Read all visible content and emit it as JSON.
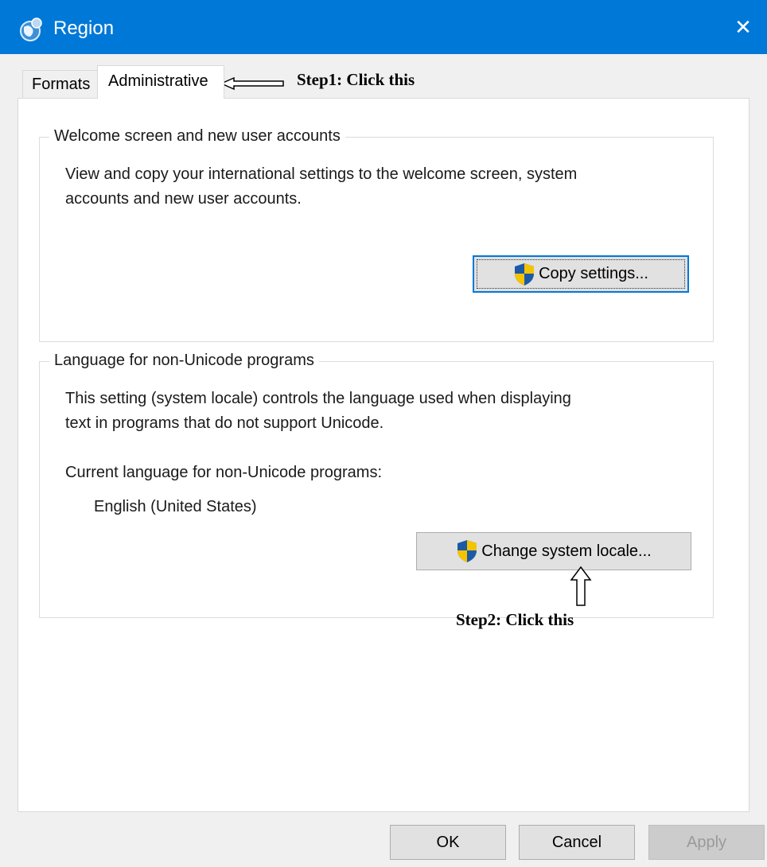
{
  "window": {
    "title": "Region",
    "close_glyph": "✕",
    "accent_color": "#0078d7"
  },
  "tabs": [
    {
      "label": "Formats",
      "active": false
    },
    {
      "label": "Administrative",
      "active": true
    }
  ],
  "annotations": {
    "step1": "Step1: Click this",
    "step2": "Step2: Click this"
  },
  "welcome_group": {
    "legend": "Welcome screen and new user accounts",
    "description_line1": "View and copy your international settings to the welcome screen, system",
    "description_line2": "accounts and new user accounts.",
    "button_label": "Copy settings...",
    "button_icon": "uac-shield-icon"
  },
  "unicode_group": {
    "legend": "Language for non-Unicode programs",
    "description_line1": "This setting (system locale) controls the language used when displaying",
    "description_line2": "text in programs that do not support Unicode.",
    "current_label": "Current language for non-Unicode programs:",
    "current_value": "English (United States)",
    "button_label": "Change system locale...",
    "button_icon": "uac-shield-icon"
  },
  "footer": {
    "ok_label": "OK",
    "cancel_label": "Cancel",
    "apply_label": "Apply",
    "apply_enabled": false
  }
}
